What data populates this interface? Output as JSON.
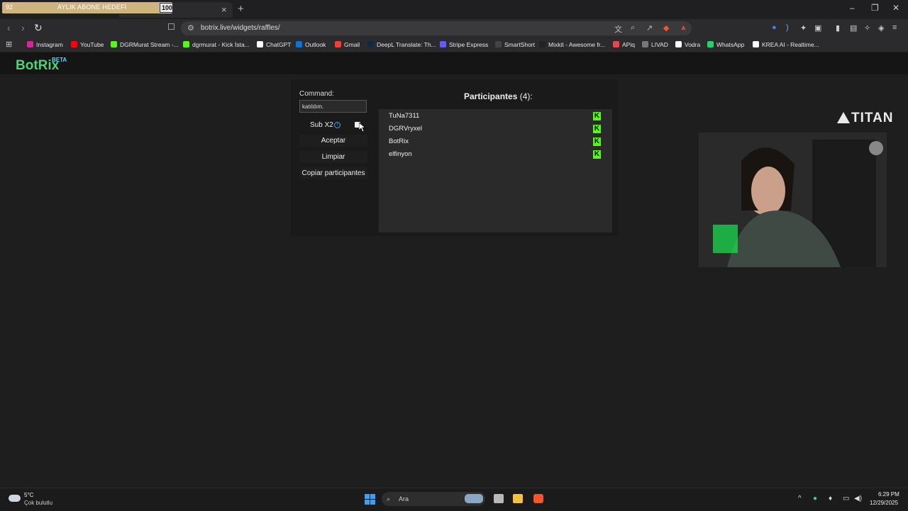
{
  "stream_goal": {
    "start": "92",
    "title": "AYLIK ABONE HEDEFİ",
    "end": "100",
    "progress_fraction": 0.92
  },
  "browser": {
    "url": "botrix.live/widgets/raffles/",
    "bookmarks": [
      {
        "label": "Instagram",
        "icon_color": "#d6249f"
      },
      {
        "label": "YouTube",
        "icon_color": "#ff0000"
      },
      {
        "label": "DGRMurat Stream -...",
        "icon_color": "#53fc18"
      },
      {
        "label": "dgrmurat - Kick İsta...",
        "icon_color": "#53fc18"
      },
      {
        "label": "ChatGPT",
        "icon_color": "#ffffff"
      },
      {
        "label": "Outlook",
        "icon_color": "#0a74d8"
      },
      {
        "label": "Gmail",
        "icon_color": "#ea4335"
      },
      {
        "label": "DeepL Translate: Th...",
        "icon_color": "#0f2b46"
      },
      {
        "label": "Stripe Express",
        "icon_color": "#635bff"
      },
      {
        "label": "SmartShort",
        "icon_color": "#444444"
      },
      {
        "label": "Mixkit - Awesome fr...",
        "icon_color": "#222222"
      },
      {
        "label": "APiq",
        "icon_color": "#e54848"
      },
      {
        "label": "LIVAD",
        "icon_color": "#777777"
      },
      {
        "label": "Vodra",
        "icon_color": "#ffffff"
      },
      {
        "label": "WhatsApp",
        "icon_color": "#25d366"
      },
      {
        "label": "KREA AI - Realtime...",
        "icon_color": "#ffffff"
      }
    ]
  },
  "site": {
    "logo": "BotRix",
    "logo_badge": "BETA"
  },
  "raffle": {
    "command_label": "Command:",
    "command_value": "katıldım.",
    "sub_label": "Sub X2",
    "accept_label": "Aceptar",
    "clear_label": "Limpiar",
    "copy_label": "Copiar participantes",
    "participants_title": "Participantes",
    "participants_count": "(4):",
    "participants": [
      "TuNa7311",
      "DGRVryxel",
      "BotRix",
      "elfinyon"
    ]
  },
  "overlay": {
    "sponsor": "TITAN"
  },
  "taskbar": {
    "weather_temp": "5°C",
    "weather_condition": "Çok bulutlu",
    "search_placeholder": "Ara",
    "time": "6:29 PM",
    "date": "12/29/2025"
  },
  "colors": {
    "brand_green": "#4fd27a",
    "kick_green": "#53fc18",
    "goal_fill": "#cfb47d"
  }
}
